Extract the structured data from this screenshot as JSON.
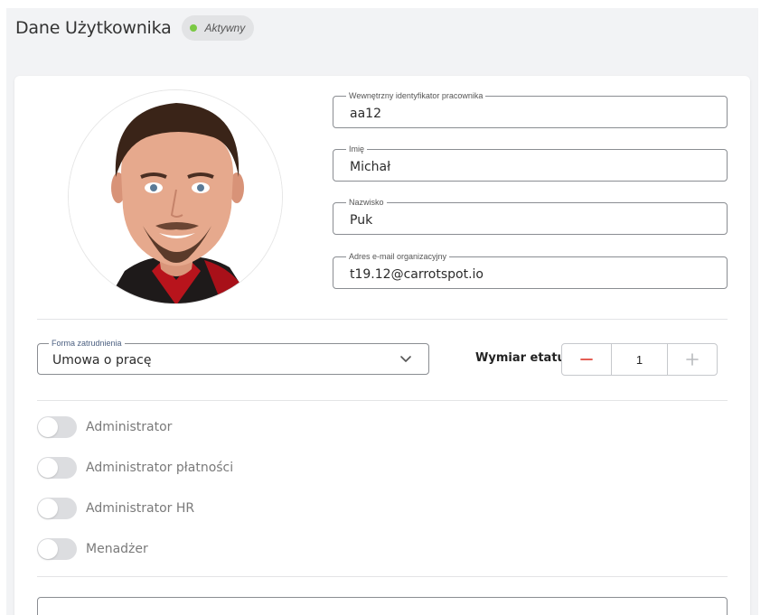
{
  "header": {
    "title": "Dane Użytkownika",
    "status": "Aktywny",
    "status_color": "#7ac943"
  },
  "fields": [
    {
      "label": "Wewnętrzny identyfikator pracownika",
      "value": "aa12"
    },
    {
      "label": "Imię",
      "value": "Michał"
    },
    {
      "label": "Nazwisko",
      "value": "Puk"
    },
    {
      "label": "Adres e-mail organizacyjny",
      "value": "t19.12@carrotspot.io"
    }
  ],
  "employment": {
    "label": "Forma zatrudnienia",
    "value": "Umowa o pracę"
  },
  "workload": {
    "label": "Wymiar etatu",
    "value": "1",
    "decrement_icon": "minus-icon",
    "increment_icon": "plus-icon"
  },
  "roles": [
    {
      "label": "Administrator",
      "enabled": false
    },
    {
      "label": "Administrator płatności",
      "enabled": false
    },
    {
      "label": "Administrator HR",
      "enabled": false
    },
    {
      "label": "Menadżer",
      "enabled": false
    }
  ],
  "colors": {
    "accent_red": "#e0483c",
    "toggle_off": "#dcdde0",
    "badge_bg": "#e2e3e5"
  }
}
